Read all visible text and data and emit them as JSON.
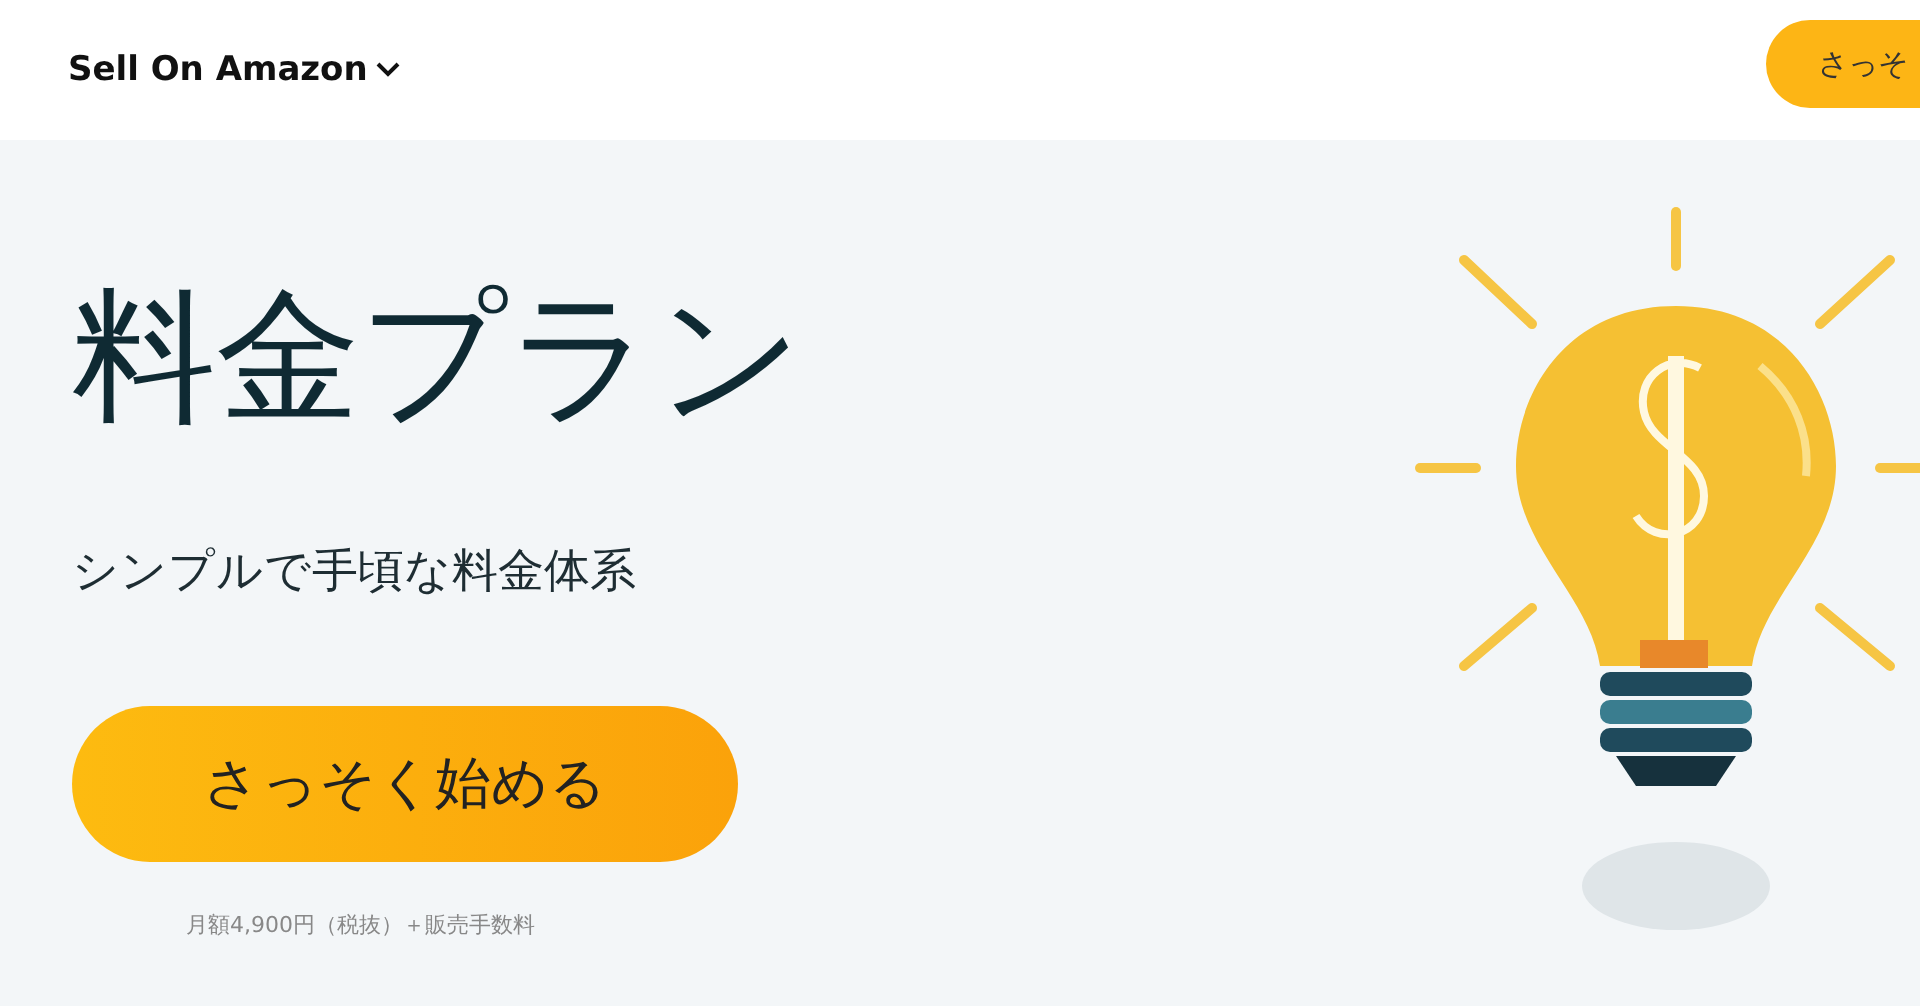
{
  "header": {
    "brand": "Sell On Amazon",
    "cta": "さっそ"
  },
  "hero": {
    "title": "料金プラン",
    "subtitle": "シンプルで手頃な料金体系",
    "button": "さっそく始める",
    "note": "月額4,900円（税抜）＋販売手数料"
  }
}
